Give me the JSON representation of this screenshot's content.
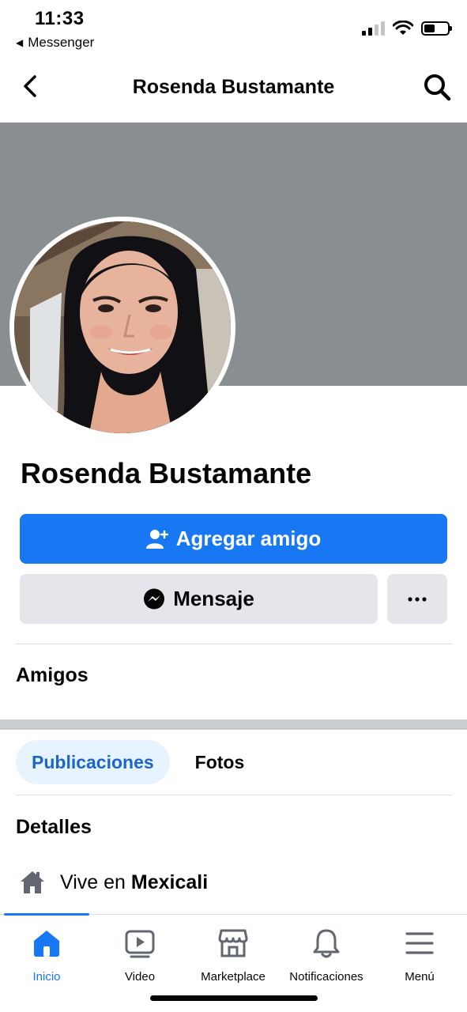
{
  "status_bar": {
    "time": "11:33",
    "back_app": "Messenger"
  },
  "header": {
    "title": "Rosenda Bustamante"
  },
  "profile": {
    "name": "Rosenda Bustamante",
    "cover_color": "#898e91"
  },
  "actions": {
    "add_friend_label": "Agregar amigo",
    "message_label": "Mensaje"
  },
  "sections": {
    "friends_title": "Amigos",
    "details_title": "Detalles"
  },
  "tabs": [
    {
      "label": "Publicaciones",
      "active": true
    },
    {
      "label": "Fotos",
      "active": false
    }
  ],
  "details": {
    "lives_prefix": "Vive en",
    "city": "Mexicali"
  },
  "bottom_nav": [
    {
      "label": "Inicio",
      "icon": "home-icon",
      "active": true
    },
    {
      "label": "Video",
      "icon": "video-icon",
      "active": false
    },
    {
      "label": "Marketplace",
      "icon": "marketplace-icon",
      "active": false
    },
    {
      "label": "Notificaciones",
      "icon": "bell-icon",
      "active": false
    },
    {
      "label": "Menú",
      "icon": "menu-icon",
      "active": false
    }
  ],
  "colors": {
    "accent": "#1877f2",
    "tab_active_bg": "#e7f3ff",
    "button_secondary": "#e4e6eb"
  }
}
